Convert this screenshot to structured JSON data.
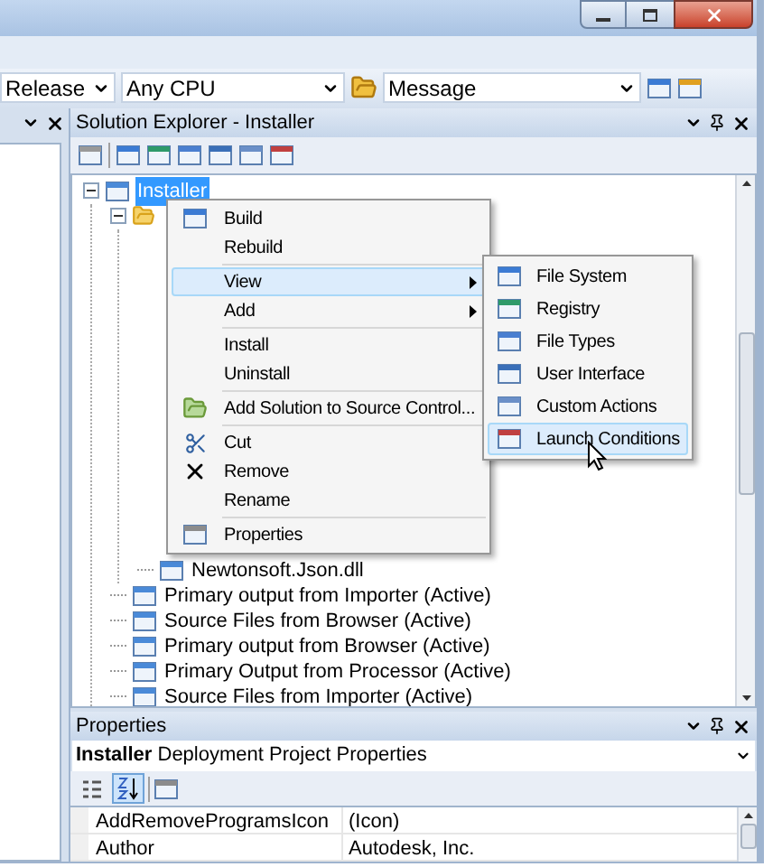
{
  "toolbar": {
    "configuration": "Release",
    "platform": "Any CPU",
    "find_box": "Message"
  },
  "solution_explorer": {
    "title": "Solution Explorer - Installer",
    "tree": [
      {
        "label": "Installer",
        "selected": true,
        "expanded": true,
        "children": [
          {
            "expanded": true,
            "children": [
              {
                "label": "Newtonsoft.Json.dll",
                "selected": false
              }
            ]
          },
          {
            "label": "Primary output from Importer (Active)",
            "selected": false
          },
          {
            "label": "Source Files from Browser (Active)",
            "selected": false
          },
          {
            "label": "Primary output from Browser (Active)",
            "selected": false
          },
          {
            "label": "Primary Output from Processor (Active)",
            "selected": false
          },
          {
            "label": "Source Files from Importer (Active)",
            "selected": false
          }
        ]
      }
    ]
  },
  "context_menu": {
    "items": [
      {
        "kind": "item",
        "label": "Build",
        "selected": false,
        "submenu": false
      },
      {
        "kind": "item",
        "label": "Rebuild",
        "selected": false,
        "submenu": false
      },
      {
        "kind": "separator"
      },
      {
        "kind": "item",
        "label": "View",
        "selected": true,
        "submenu": true
      },
      {
        "kind": "item",
        "label": "Add",
        "selected": false,
        "submenu": true
      },
      {
        "kind": "separator"
      },
      {
        "kind": "item",
        "label": "Install",
        "selected": false,
        "submenu": false
      },
      {
        "kind": "item",
        "label": "Uninstall",
        "selected": false,
        "submenu": false
      },
      {
        "kind": "separator"
      },
      {
        "kind": "item",
        "label": "Add Solution to Source Control...",
        "selected": false,
        "submenu": false
      },
      {
        "kind": "separator"
      },
      {
        "kind": "item",
        "label": "Cut",
        "selected": false,
        "submenu": false
      },
      {
        "kind": "item",
        "label": "Remove",
        "selected": false,
        "submenu": false
      },
      {
        "kind": "item",
        "label": "Rename",
        "selected": false,
        "submenu": false
      },
      {
        "kind": "separator"
      },
      {
        "kind": "item",
        "label": "Properties",
        "selected": false,
        "submenu": false
      }
    ]
  },
  "view_submenu": {
    "items": [
      {
        "label": "File System",
        "selected": false
      },
      {
        "label": "Registry",
        "selected": false
      },
      {
        "label": "File Types",
        "selected": false
      },
      {
        "label": "User Interface",
        "selected": false
      },
      {
        "label": "Custom Actions",
        "selected": false
      },
      {
        "label": "Launch Conditions",
        "selected": true
      }
    ]
  },
  "properties": {
    "title": "Properties",
    "object_name": "Installer",
    "object_type": "Deployment Project Properties",
    "sort_buttons": [
      {
        "selected": false
      },
      {
        "selected": true
      }
    ],
    "rows": [
      {
        "name": "AddRemoveProgramsIcon",
        "value": "(Icon)"
      },
      {
        "name": "Author",
        "value": "Autodesk, Inc."
      }
    ]
  }
}
